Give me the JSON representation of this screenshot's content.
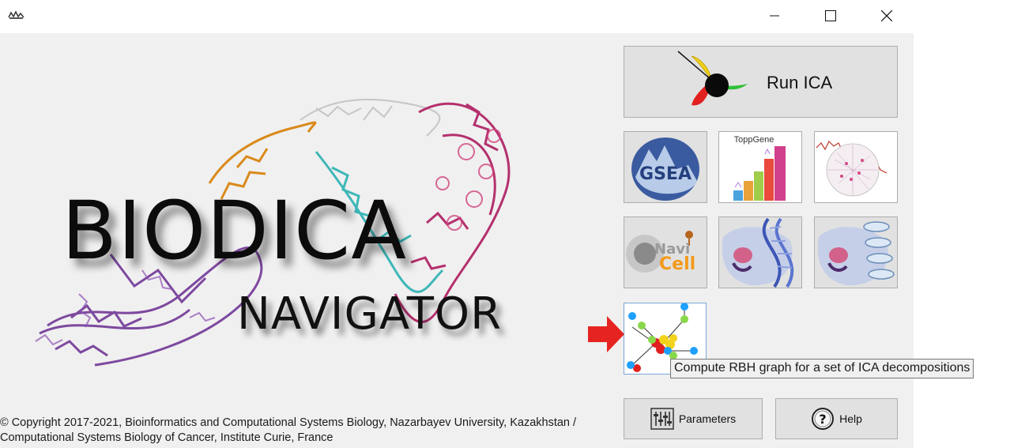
{
  "window": {
    "app_icon": "biodica-app-icon",
    "controls": [
      "minimize-icon",
      "maximize-icon",
      "close-icon"
    ]
  },
  "logo": {
    "title": "BIODICA",
    "subtitle": "NAVIGATOR"
  },
  "buttons": {
    "run_ica_label": "Run ICA",
    "gsea_label": "GSEA",
    "toppgene_label": "ToppGene",
    "navicell_label_1": "Navi",
    "navicell_label_2": "Cell",
    "parameters_label": "Parameters",
    "help_label": "Help"
  },
  "tooltip": {
    "text": "Compute RBH graph for a set of ICA decompositions"
  },
  "footer": {
    "copyright_line1": "© Copyright 2017-2021, Bioinformatics and Computational Systems Biology, Nazarbayev University, Kazakhstan /",
    "copyright_line2": "Computational Systems Biology of Cancer, Institute Curie, France"
  },
  "colors": {
    "client_bg": "#f0f0f0",
    "button_bg": "#e1e1e1",
    "arrow": "#e52421",
    "hover_border": "#7aa7d6"
  }
}
